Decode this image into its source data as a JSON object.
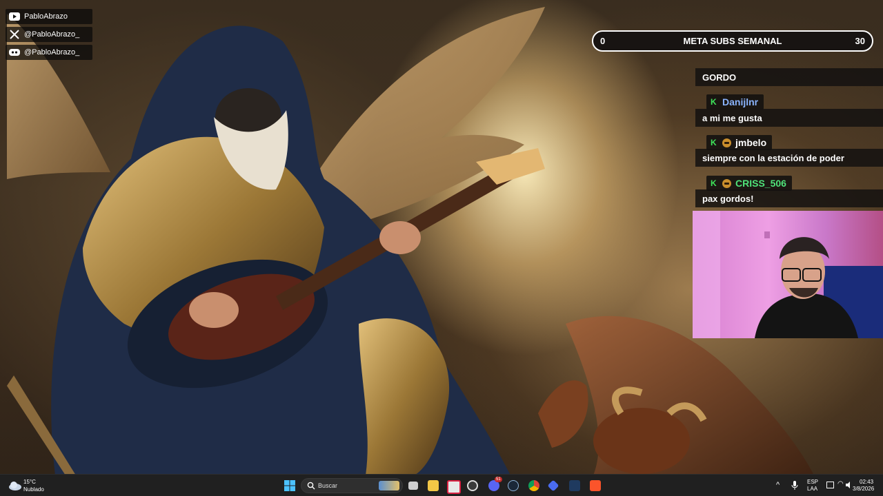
{
  "socials": [
    {
      "icon": "youtube-icon",
      "label": "PabloAbrazo"
    },
    {
      "icon": "x-twitter-icon",
      "label": "@PabloAbrazo_"
    },
    {
      "icon": "discord-icon",
      "label": "@PabloAbrazo_"
    }
  ],
  "goal": {
    "start": "0",
    "title": "META SUBS SEMANAL",
    "target": "30"
  },
  "chat": {
    "partial_message": "GORDO",
    "messages": [
      {
        "user": "Danijlnr",
        "user_color": "#8ab4ff",
        "text": "a mi me gusta",
        "badges": [
          "kick-badge"
        ]
      },
      {
        "user": "jmbelo",
        "user_color": "#ffffff",
        "text": "siempre con la estación de poder",
        "badges": [
          "kick-badge",
          "sub-badge"
        ]
      },
      {
        "user": "CRISS_506",
        "user_color": "#4fe37a",
        "text": "pax gordos!",
        "badges": [
          "kick-badge",
          "sub-badge"
        ]
      }
    ]
  },
  "taskbar": {
    "weather_temp": "15°C",
    "weather_desc": "Nublado",
    "search_placeholder": "Buscar",
    "discord_badge": "51",
    "lang_top": "ESP",
    "lang_bottom": "LAA",
    "time": "02:43",
    "date": "3/8/2026"
  },
  "colors": {
    "taskbar": "#202020",
    "kick_green": "#3fe55b",
    "goal_border": "#ffffff"
  }
}
